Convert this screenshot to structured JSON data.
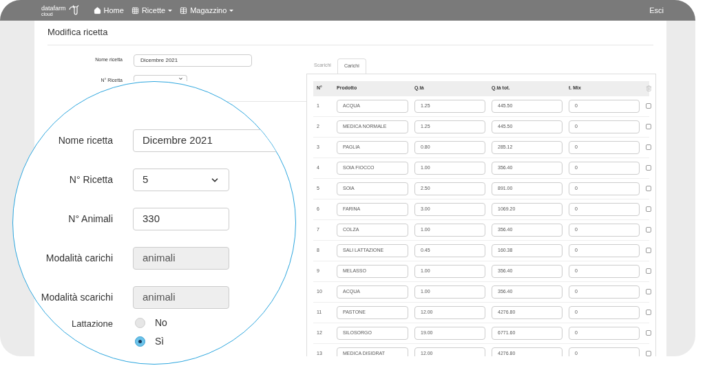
{
  "nav": {
    "logo": "datafarm",
    "logo_sub": "cloud",
    "items": [
      {
        "label": "Home",
        "dropdown": false
      },
      {
        "label": "Ricette",
        "dropdown": true
      },
      {
        "label": "Magazzino",
        "dropdown": true
      }
    ],
    "logout": "Esci"
  },
  "page_title": "Modifica ricetta",
  "form": {
    "fields": [
      {
        "label": "Nome ricetta",
        "kind": "text",
        "value": "Dicembre 2021"
      },
      {
        "label": "N° Ricetta",
        "kind": "select"
      }
    ]
  },
  "magnifier": {
    "fields": [
      {
        "label": "Nome ricetta",
        "kind": "text",
        "value": "Dicembre 2021"
      },
      {
        "label": "N° Ricetta",
        "kind": "select",
        "value": "5"
      },
      {
        "label": "N° Animali",
        "kind": "text",
        "value": "330"
      },
      {
        "label": "Modalità carichi",
        "kind": "readonly",
        "value": "animali"
      },
      {
        "label": "Modalità scarichi",
        "kind": "readonly",
        "value": "animali"
      }
    ],
    "radio": {
      "label": "Lattazione",
      "options": [
        {
          "label": "No",
          "selected": false
        },
        {
          "label": "Sì",
          "selected": true
        }
      ]
    }
  },
  "tabs": [
    {
      "label": "Scarichi",
      "selected": false
    },
    {
      "label": "Carichi",
      "selected": true
    }
  ],
  "table": {
    "columns": [
      "N°",
      "Prodotto",
      "Q.tà",
      "Q.tà tot.",
      "t. Mix"
    ],
    "rows": [
      {
        "n": "1",
        "product": "ACQUA",
        "qty": "1.25",
        "total": "445.50",
        "mix": "0",
        "checked": false
      },
      {
        "n": "2",
        "product": "MEDICA NORMALE",
        "qty": "1.25",
        "total": "445.50",
        "mix": "0",
        "checked": false
      },
      {
        "n": "3",
        "product": "PAGLIA",
        "qty": "0.80",
        "total": "285.12",
        "mix": "0",
        "checked": false
      },
      {
        "n": "4",
        "product": "SOIA FIOCCO",
        "qty": "1.00",
        "total": "356.40",
        "mix": "0",
        "checked": false
      },
      {
        "n": "5",
        "product": "SOIA",
        "qty": "2.50",
        "total": "891.00",
        "mix": "0",
        "checked": false
      },
      {
        "n": "6",
        "product": "FARINA",
        "qty": "3.00",
        "total": "1069.20",
        "mix": "0",
        "checked": false
      },
      {
        "n": "7",
        "product": "COLZA",
        "qty": "1.00",
        "total": "356.40",
        "mix": "0",
        "checked": false
      },
      {
        "n": "8",
        "product": "SALI LATTAZIONE",
        "qty": "0.45",
        "total": "160.38",
        "mix": "0",
        "checked": false
      },
      {
        "n": "9",
        "product": "MELASSO",
        "qty": "1.00",
        "total": "356.40",
        "mix": "0",
        "checked": false
      },
      {
        "n": "10",
        "product": "ACQUA",
        "qty": "1.00",
        "total": "356.40",
        "mix": "0",
        "checked": false
      },
      {
        "n": "11",
        "product": "PASTONE",
        "qty": "12.00",
        "total": "4276.80",
        "mix": "0",
        "checked": false
      },
      {
        "n": "12",
        "product": "SILOSORGO",
        "qty": "19.00",
        "total": "6771.60",
        "mix": "0",
        "checked": false
      },
      {
        "n": "13",
        "product": "MEDICA DISIDRAT",
        "qty": "12.00",
        "total": "4276.80",
        "mix": "0",
        "checked": false
      }
    ]
  }
}
